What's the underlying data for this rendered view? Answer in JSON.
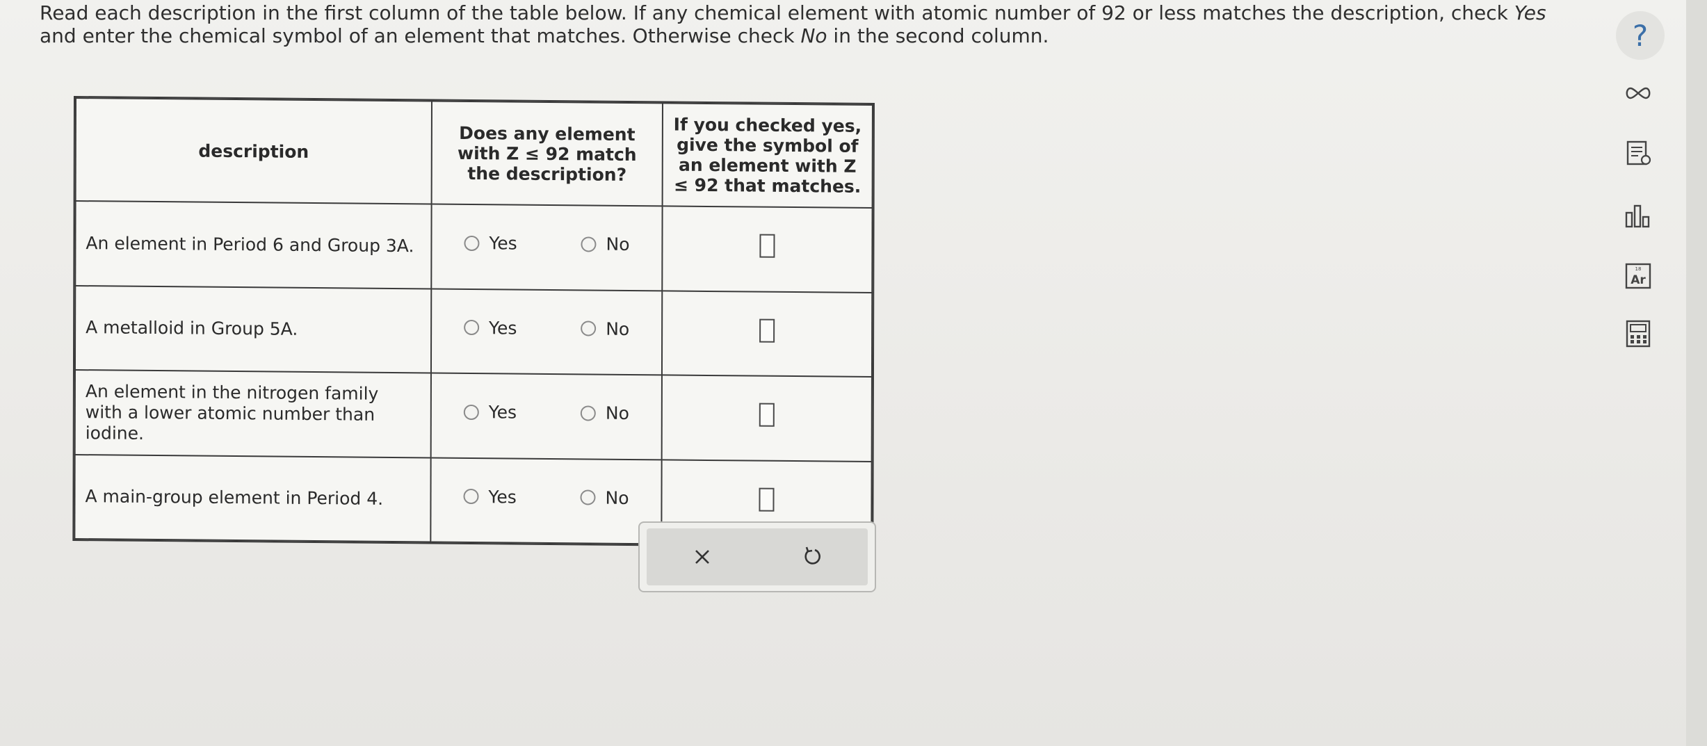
{
  "instructions": {
    "part1": "Read each description in the first column of the table below. If any chemical element with atomic number of 92 or less matches the description, check ",
    "yes_word": "Yes",
    "part2": " and enter the chemical symbol of an element that matches. Otherwise check ",
    "no_word": "No",
    "part3": " in the second column."
  },
  "help": {
    "label": "?"
  },
  "toolbar": {
    "periodic_table_symbol": "Ar",
    "periodic_table_number": "18",
    "icons": [
      "infinity-icon",
      "notes-icon",
      "bar-chart-icon",
      "periodic-table-icon",
      "calculator-icon"
    ]
  },
  "table": {
    "headers": {
      "description": "description",
      "match": "Does any element with Z ≤ 92 match the description?",
      "symbol": "If you checked yes, give the symbol of an element with Z ≤ 92 that matches."
    },
    "rows": [
      {
        "description": "An element in Period 6 and Group 3A.",
        "yes_label": "Yes",
        "no_label": "No",
        "symbol_value": ""
      },
      {
        "description": "A metalloid in Group 5A.",
        "yes_label": "Yes",
        "no_label": "No",
        "symbol_value": ""
      },
      {
        "description": "An element in the nitrogen family with a lower atomic number than iodine.",
        "yes_label": "Yes",
        "no_label": "No",
        "symbol_value": ""
      },
      {
        "description": "A main-group element in Period 4.",
        "yes_label": "Yes",
        "no_label": "No",
        "symbol_value": ""
      }
    ]
  },
  "actions": {
    "clear_icon": "close-icon",
    "undo_icon": "undo-icon"
  },
  "colors": {
    "accent": "#3b6fa8",
    "border": "#3a3a3a",
    "panel": "#d8d8d5"
  }
}
